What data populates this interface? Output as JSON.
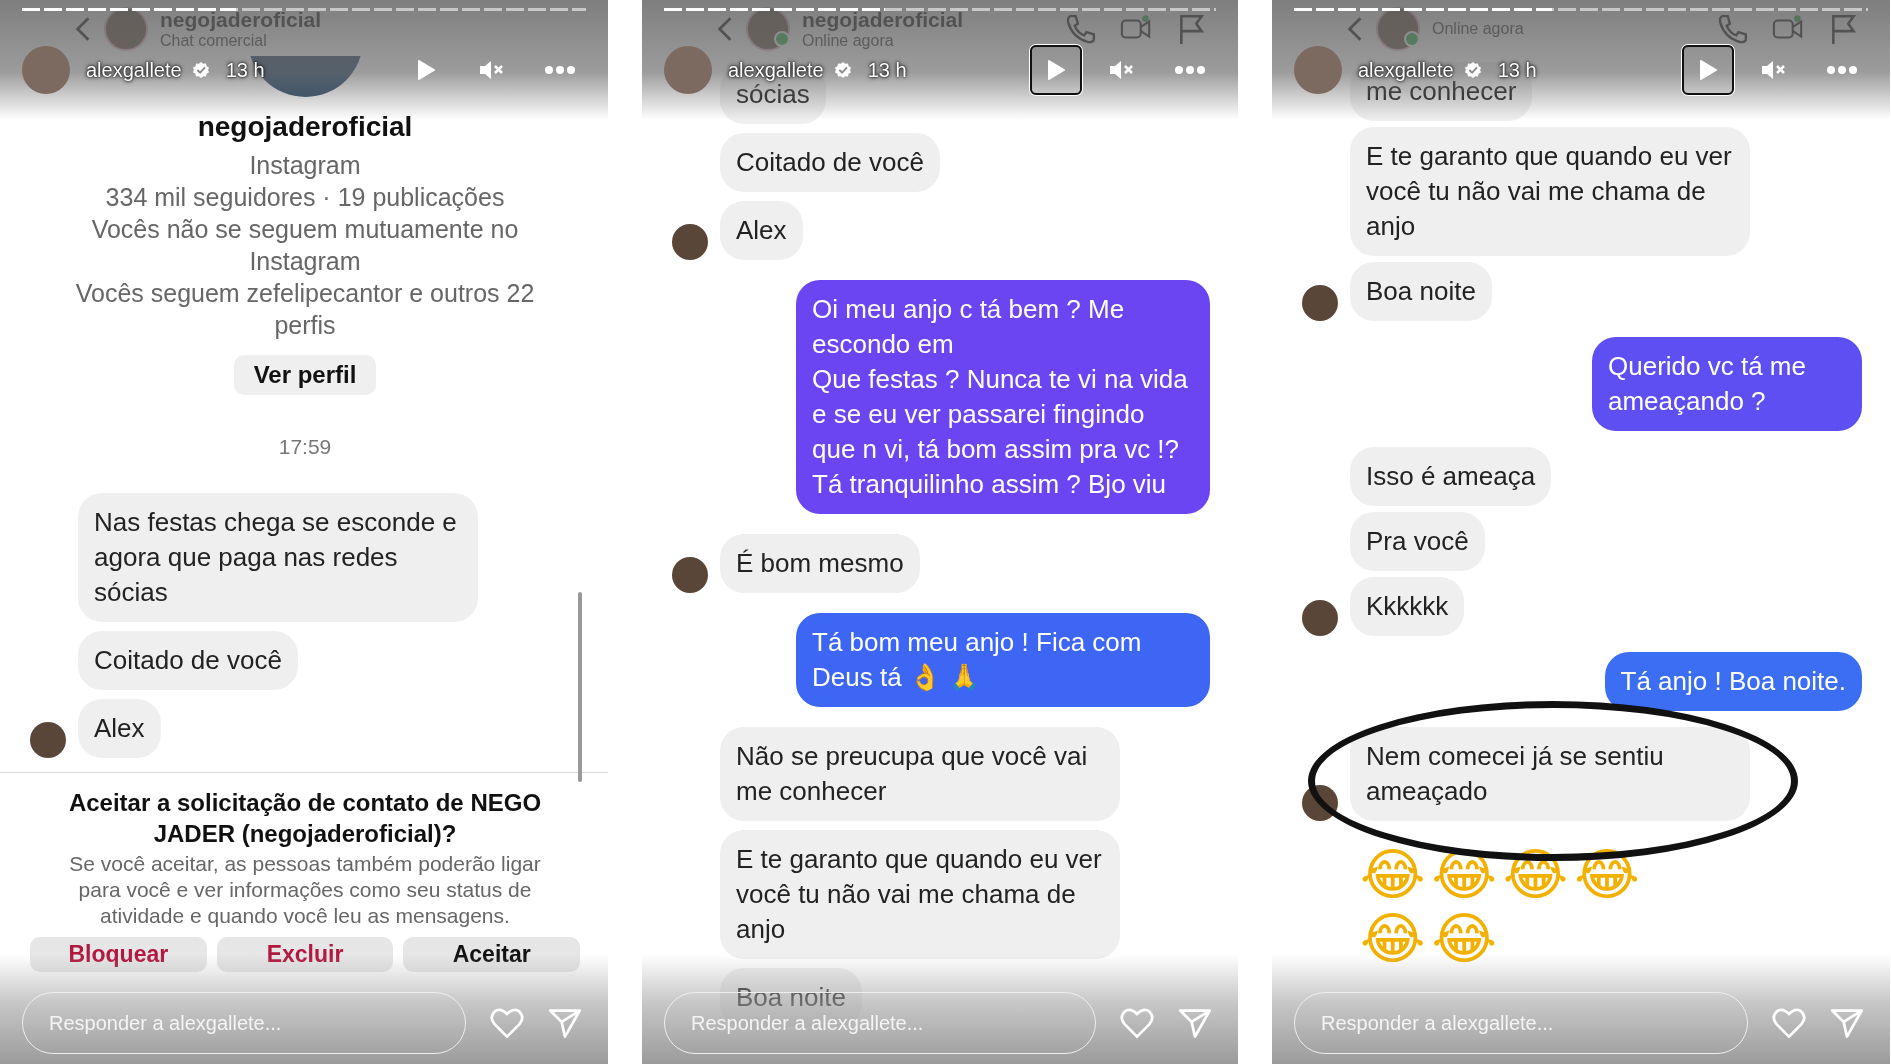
{
  "stories": [
    {
      "progress": {
        "level": 0.38
      },
      "header": {
        "username": "alexgallete",
        "time": "13 h",
        "play_focused": false
      },
      "chat_header": {
        "name": "negojaderoficial",
        "subtitle": "Chat comercial",
        "online": false,
        "actions": false
      },
      "scrollbar": true,
      "items": [
        {
          "kind": "profile",
          "name": "negojaderoficial",
          "platform": "Instagram",
          "stats": "334 mil seguidores · 19 publicações",
          "mutual": "Vocês não se seguem mutuamente no Instagram",
          "followed": "Vocês seguem zefelipecantor e outros 22 perfis",
          "button": "Ver perfil"
        },
        {
          "kind": "time",
          "text": "17:59"
        },
        {
          "kind": "message",
          "outgoing": false,
          "text": "Nas festas chega se esconde e agora que paga nas redes sócias",
          "avatar": false
        },
        {
          "kind": "message",
          "outgoing": false,
          "text": "Coitado de você",
          "avatar": false
        },
        {
          "kind": "message",
          "outgoing": false,
          "text": "Alex",
          "avatar": true
        },
        {
          "kind": "request",
          "title": "Aceitar a solicitação de contato de NEGO JADER (negojaderoficial)?",
          "body": "Se você aceitar, as pessoas também poderão ligar para você e ver informações como seu status de atividade e quando você leu as mensagens.",
          "buttons": [
            {
              "label": "Bloquear",
              "danger": true
            },
            {
              "label": "Excluir",
              "danger": true
            },
            {
              "label": "Aceitar",
              "danger": false
            }
          ]
        }
      ],
      "reply": {
        "placeholder": "Responder a alexgallete..."
      }
    },
    {
      "progress": {
        "level": 0.4
      },
      "header": {
        "username": "alexgallete",
        "time": "13 h",
        "play_focused": true
      },
      "chat_header": {
        "name": "negojaderoficial",
        "subtitle": "Online agora",
        "online": true,
        "actions": true
      },
      "scrollbar": false,
      "items": [
        {
          "kind": "message",
          "outgoing": false,
          "text": "sócias",
          "avatar": false
        },
        {
          "kind": "message",
          "outgoing": false,
          "text": "Coitado de você",
          "avatar": false
        },
        {
          "kind": "message",
          "outgoing": false,
          "text": "Alex",
          "avatar": true
        },
        {
          "kind": "message",
          "outgoing": true,
          "text": "Oi meu anjo c tá bem ? Me escondo em\nQue festas ? Nunca te vi na vida e se eu ver passarei fingindo que n vi, tá bom assim pra vc !? Tá tranquilinho assim ? Bjo viu",
          "color": "#6b45f1"
        },
        {
          "kind": "message",
          "outgoing": false,
          "text": "É bom mesmo",
          "avatar": true
        },
        {
          "kind": "message",
          "outgoing": true,
          "text": "Tá bom meu anjo ! Fica com Deus tá 👌 🙏",
          "color": "#3d66f4"
        },
        {
          "kind": "message",
          "outgoing": false,
          "text": "Não se preucupa que você vai me conhecer",
          "avatar": false
        },
        {
          "kind": "message",
          "outgoing": false,
          "text": "E te garanto que quando eu ver você tu não vai me chama de anjo",
          "avatar": false
        },
        {
          "kind": "message",
          "outgoing": false,
          "text": "Boa noite",
          "avatar": false
        }
      ],
      "reply": {
        "placeholder": "Responder a alexgallete..."
      }
    },
    {
      "progress": {
        "level": 0.45
      },
      "header": {
        "username": "alexgallete",
        "time": "13 h",
        "play_focused": true
      },
      "chat_header": {
        "subtitle": "Online agora",
        "online": true,
        "actions": true
      },
      "scrollbar": false,
      "items": [
        {
          "kind": "message",
          "outgoing": false,
          "text": "me conhecer",
          "avatar": false
        },
        {
          "kind": "message",
          "outgoing": false,
          "text": "E te garanto que quando eu ver você tu não vai me chama de anjo",
          "avatar": false
        },
        {
          "kind": "message",
          "outgoing": false,
          "text": "Boa noite",
          "avatar": true
        },
        {
          "kind": "message",
          "outgoing": true,
          "text": "Querido vc tá me ameaçando ?",
          "color": "#5d4ff1"
        },
        {
          "kind": "message",
          "outgoing": false,
          "text": "Isso é ameaça",
          "avatar": false
        },
        {
          "kind": "message",
          "outgoing": false,
          "text": "Pra você",
          "avatar": false
        },
        {
          "kind": "message",
          "outgoing": false,
          "text": "Kkkkkk",
          "avatar": true
        },
        {
          "kind": "message",
          "outgoing": true,
          "text": "Tá anjo ! Boa noite.",
          "color": "#3c6ef4"
        },
        {
          "kind": "message",
          "outgoing": false,
          "text": "Nem comecei já se sentiu ameaçado",
          "avatar": true,
          "circled": true
        },
        {
          "kind": "emoji",
          "text": "😂😂😂😂"
        },
        {
          "kind": "emoji",
          "text": "😂😂"
        }
      ],
      "reply": {
        "placeholder": "Responder a alexgallete..."
      }
    }
  ]
}
